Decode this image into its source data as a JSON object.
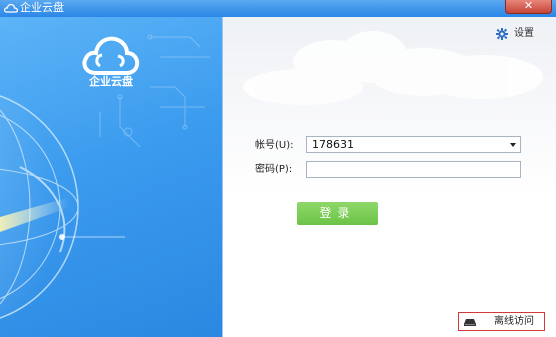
{
  "window": {
    "title": "企业云盘",
    "close_label": "✕"
  },
  "banner": {
    "logo_text": "企业云盘"
  },
  "settings": {
    "label": "设置",
    "icon": "gear-icon"
  },
  "form": {
    "account_label": "帐号(U):",
    "account_value": "178631",
    "password_label": "密码(P):",
    "password_value": "",
    "login_label": "登录"
  },
  "footer": {
    "offline_label": "离线访问",
    "offline_icon": "hard-drive-icon"
  },
  "colors": {
    "title_bar": "#2a86e6",
    "banner": "#3b9bee",
    "login_button": "#6cc346",
    "offline_border": "#d23a3a"
  }
}
